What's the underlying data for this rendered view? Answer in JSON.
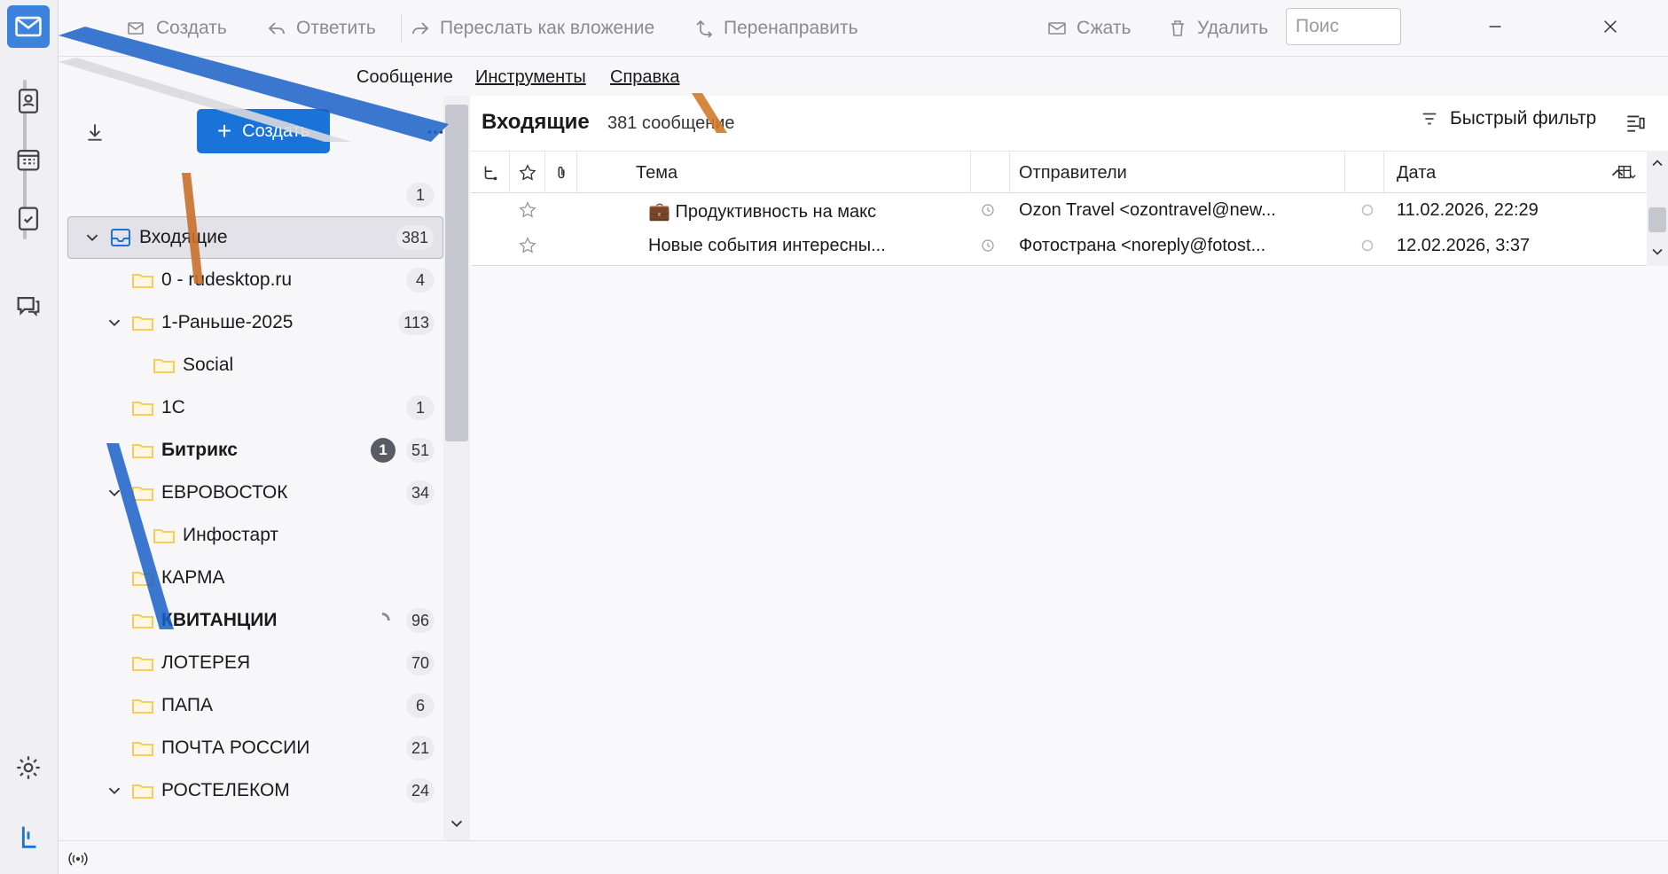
{
  "colors": {
    "accent": "#1a73d8",
    "space_active": "#3d82dc",
    "folder_yellow": "#f7c64a",
    "unread_badge": "#5b5b66"
  },
  "spaces": [
    {
      "icon": "mail-icon",
      "active": true
    },
    {
      "icon": "address-book-icon"
    },
    {
      "icon": "calendar-icon"
    },
    {
      "icon": "tasks-icon"
    },
    {
      "icon": "chat-icon"
    },
    {
      "icon": "settings-icon"
    },
    {
      "icon": "collapse-spaces-icon"
    }
  ],
  "toolbar": {
    "compose": "Создать",
    "reply": "Ответить",
    "forward": "Переслать как вложение",
    "redirect": "Перенаправить",
    "compact": "Сжать",
    "delete": "Удалить",
    "search_placeholder": "Поис"
  },
  "menu": {
    "message": "Сообщение",
    "tools": "Инструменты",
    "help": "Справка"
  },
  "folder_pane": {
    "new_button": "Создать",
    "folders": [
      {
        "name": "",
        "count": "1",
        "level": 0
      },
      {
        "name": "Входящие",
        "count": "381",
        "level": 0,
        "selected": true,
        "expanded": true,
        "icon": "inbox-icon"
      },
      {
        "name": "0 - rudesktop.ru",
        "count": "4",
        "level": 1
      },
      {
        "name": "1-Раньше-2025",
        "count": "113",
        "level": 1,
        "expanded": true
      },
      {
        "name": "Social",
        "count": "",
        "level": 2
      },
      {
        "name": "1С",
        "count": "1",
        "level": 1
      },
      {
        "name": "Битрикс",
        "count": "51",
        "unread": "1",
        "bold": true,
        "level": 1
      },
      {
        "name": "ЕВРОВОСТОК",
        "count": "34",
        "level": 1,
        "expanded": true
      },
      {
        "name": "Инфостарт",
        "count": "",
        "level": 2
      },
      {
        "name": "КАРМА",
        "count": "",
        "level": 1
      },
      {
        "name": "КВИТАНЦИИ",
        "count": "96",
        "bold": true,
        "level": 1,
        "spinner": true
      },
      {
        "name": "ЛОТЕРЕЯ",
        "count": "70",
        "level": 1
      },
      {
        "name": "ПАПА",
        "count": "6",
        "level": 1
      },
      {
        "name": "ПОЧТА РОССИИ",
        "count": "21",
        "level": 1
      },
      {
        "name": "РОСТЕЛЕКОМ",
        "count": "24",
        "level": 1,
        "expanded": true
      }
    ]
  },
  "thread_pane": {
    "folder_title": "Входящие",
    "message_count": "381 сообщение",
    "quick_filter": "Быстрый фильтр",
    "columns": {
      "subject": "Тема",
      "senders": "Отправители",
      "date": "Дата"
    },
    "messages": [
      {
        "subject": "💼 Продуктивность на макс",
        "sender": "Ozon Travel <ozontravel@new...",
        "date": "11.02.2026, 22:29"
      },
      {
        "subject": "Новые события интересны...",
        "sender": "Фотострана <noreply@fotost...",
        "date": "12.02.2026, 3:37"
      }
    ]
  }
}
